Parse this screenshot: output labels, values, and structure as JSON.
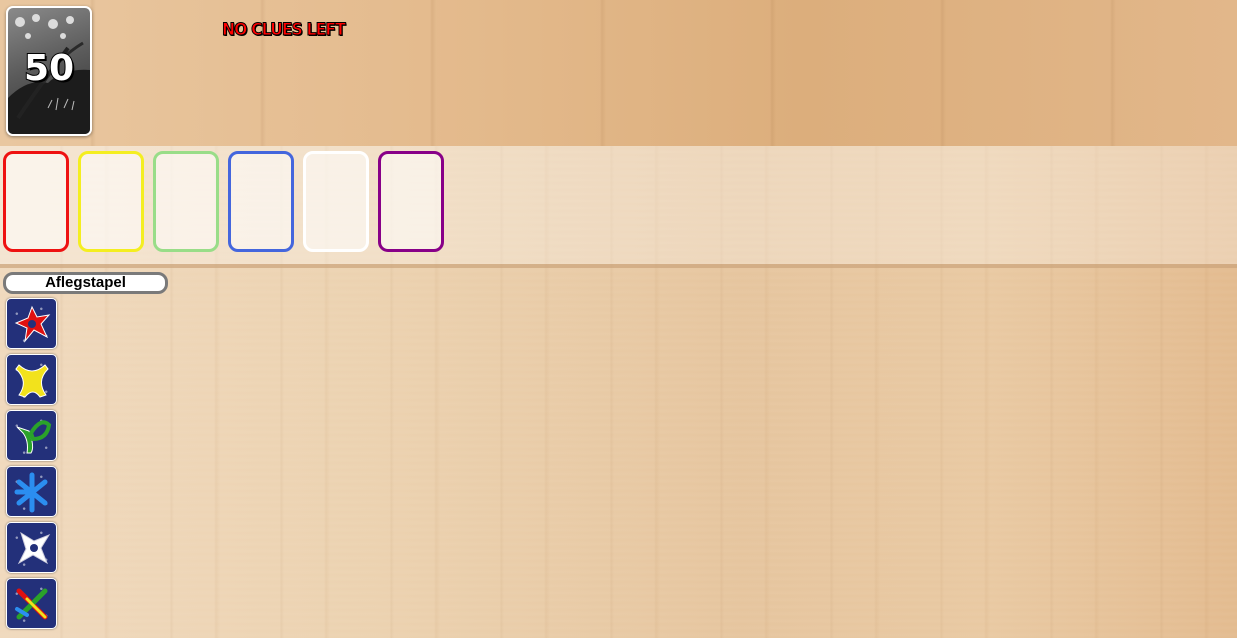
{
  "deck": {
    "count": "50"
  },
  "status": {
    "clues": "NO CLUES LEFT"
  },
  "play_stacks": [
    {
      "suit": "red",
      "color": "#ee1111"
    },
    {
      "suit": "yellow",
      "color": "#f4ee20"
    },
    {
      "suit": "green",
      "color": "#99dd88"
    },
    {
      "suit": "blue",
      "color": "#4466dd"
    },
    {
      "suit": "white",
      "color": "#ffffff"
    },
    {
      "suit": "purple",
      "color": "#880088"
    }
  ],
  "discard": {
    "label": "Aflegstapel",
    "cards": [
      {
        "suit": "red",
        "icon": "red-cross-icon"
      },
      {
        "suit": "yellow",
        "icon": "yellow-x-icon"
      },
      {
        "suit": "green",
        "icon": "green-leaf-icon"
      },
      {
        "suit": "blue",
        "icon": "blue-asterisk-icon"
      },
      {
        "suit": "white",
        "icon": "white-star-icon"
      },
      {
        "suit": "rainbow",
        "icon": "multicolor-cross-icon"
      }
    ]
  }
}
